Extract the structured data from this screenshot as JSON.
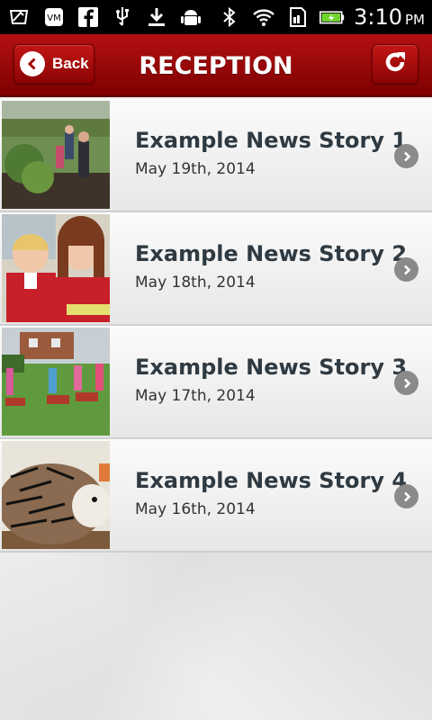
{
  "statusbar": {
    "time": "3:10",
    "ampm": "PM",
    "icons_left": [
      "messages-icon",
      "voicemail-icon",
      "facebook-icon",
      "usb-icon",
      "download-icon",
      "android-debug-icon"
    ],
    "icons_right": [
      "bluetooth-icon",
      "wifi-icon",
      "sd-card-icon",
      "battery-charging-icon"
    ],
    "battery_color": "#6fd42e"
  },
  "header": {
    "back_label": "Back",
    "title": "RECEPTION",
    "bg_color": "#a30b0b"
  },
  "news": [
    {
      "title": "Example News Story 1",
      "date": "May 19th, 2014",
      "image": "garden-photo"
    },
    {
      "title": "Example News Story 2",
      "date": "May 18th, 2014",
      "image": "children-reading-photo"
    },
    {
      "title": "Example News Story 3",
      "date": "May 17th, 2014",
      "image": "wheelbarrows-photo"
    },
    {
      "title": "Example News Story 4",
      "date": "May 16th, 2014",
      "image": "hedgehog-craft-photo"
    }
  ]
}
